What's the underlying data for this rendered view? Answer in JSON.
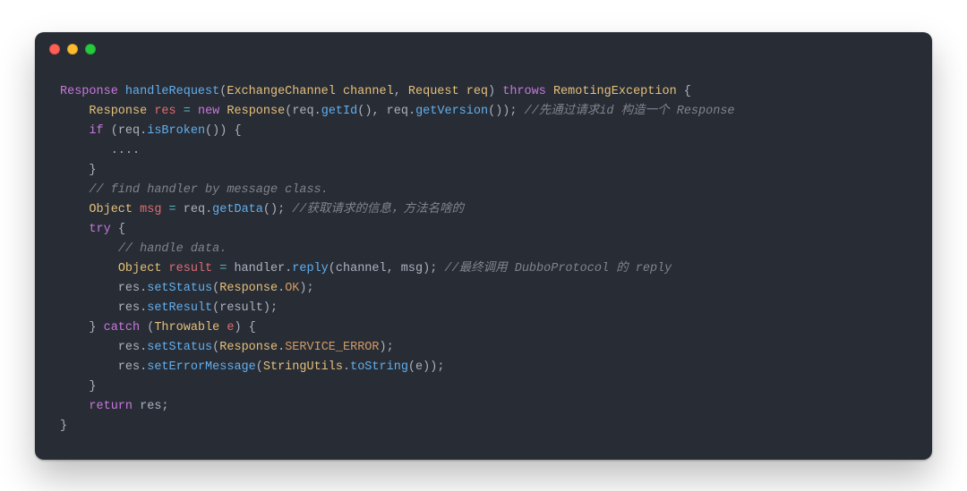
{
  "code": {
    "lines": [
      [
        {
          "cls": "tk-type",
          "t": "Response "
        },
        {
          "cls": "tk-method",
          "t": "handleRequest"
        },
        {
          "cls": "tk-punct",
          "t": "("
        },
        {
          "cls": "tk-param",
          "t": "ExchangeChannel channel"
        },
        {
          "cls": "tk-punct",
          "t": ", "
        },
        {
          "cls": "tk-param",
          "t": "Request req"
        },
        {
          "cls": "tk-punct",
          "t": ") "
        },
        {
          "cls": "tk-keyword",
          "t": "throws"
        },
        {
          "cls": "tk-punct",
          "t": " "
        },
        {
          "cls": "tk-class",
          "t": "RemotingException"
        },
        {
          "cls": "tk-punct",
          "t": " {"
        }
      ],
      [
        {
          "cls": "tk-plain",
          "t": "    "
        },
        {
          "cls": "tk-class",
          "t": "Response"
        },
        {
          "cls": "tk-plain",
          "t": " "
        },
        {
          "cls": "tk-var",
          "t": "res"
        },
        {
          "cls": "tk-plain",
          "t": " "
        },
        {
          "cls": "tk-op",
          "t": "="
        },
        {
          "cls": "tk-plain",
          "t": " "
        },
        {
          "cls": "tk-new",
          "t": "new"
        },
        {
          "cls": "tk-plain",
          "t": " "
        },
        {
          "cls": "tk-class",
          "t": "Response"
        },
        {
          "cls": "tk-punct",
          "t": "("
        },
        {
          "cls": "tk-plain",
          "t": "req"
        },
        {
          "cls": "tk-punct",
          "t": "."
        },
        {
          "cls": "tk-call",
          "t": "getId"
        },
        {
          "cls": "tk-punct",
          "t": "(), "
        },
        {
          "cls": "tk-plain",
          "t": "req"
        },
        {
          "cls": "tk-punct",
          "t": "."
        },
        {
          "cls": "tk-call",
          "t": "getVersion"
        },
        {
          "cls": "tk-punct",
          "t": "()); "
        },
        {
          "cls": "tk-comment",
          "t": "//先通过请求id 构造一个 Response"
        }
      ],
      [
        {
          "cls": "tk-plain",
          "t": "    "
        },
        {
          "cls": "tk-keyword",
          "t": "if"
        },
        {
          "cls": "tk-punct",
          "t": " ("
        },
        {
          "cls": "tk-plain",
          "t": "req"
        },
        {
          "cls": "tk-punct",
          "t": "."
        },
        {
          "cls": "tk-call",
          "t": "isBroken"
        },
        {
          "cls": "tk-punct",
          "t": "()) {"
        }
      ],
      [
        {
          "cls": "tk-plain",
          "t": "       ...."
        }
      ],
      [
        {
          "cls": "tk-plain",
          "t": "    }"
        }
      ],
      [
        {
          "cls": "tk-plain",
          "t": "    "
        },
        {
          "cls": "tk-comment",
          "t": "// find handler by message class."
        }
      ],
      [
        {
          "cls": "tk-plain",
          "t": "    "
        },
        {
          "cls": "tk-class",
          "t": "Object"
        },
        {
          "cls": "tk-plain",
          "t": " "
        },
        {
          "cls": "tk-var",
          "t": "msg"
        },
        {
          "cls": "tk-plain",
          "t": " "
        },
        {
          "cls": "tk-op",
          "t": "="
        },
        {
          "cls": "tk-plain",
          "t": " req"
        },
        {
          "cls": "tk-punct",
          "t": "."
        },
        {
          "cls": "tk-call",
          "t": "getData"
        },
        {
          "cls": "tk-punct",
          "t": "(); "
        },
        {
          "cls": "tk-comment",
          "t": "//获取请求的信息，方法名啥的"
        }
      ],
      [
        {
          "cls": "tk-plain",
          "t": "    "
        },
        {
          "cls": "tk-keyword",
          "t": "try"
        },
        {
          "cls": "tk-punct",
          "t": " {"
        }
      ],
      [
        {
          "cls": "tk-plain",
          "t": "        "
        },
        {
          "cls": "tk-comment",
          "t": "// handle data."
        }
      ],
      [
        {
          "cls": "tk-plain",
          "t": "        "
        },
        {
          "cls": "tk-class",
          "t": "Object"
        },
        {
          "cls": "tk-plain",
          "t": " "
        },
        {
          "cls": "tk-var",
          "t": "result"
        },
        {
          "cls": "tk-plain",
          "t": " "
        },
        {
          "cls": "tk-op",
          "t": "="
        },
        {
          "cls": "tk-plain",
          "t": " handler"
        },
        {
          "cls": "tk-punct",
          "t": "."
        },
        {
          "cls": "tk-call",
          "t": "reply"
        },
        {
          "cls": "tk-punct",
          "t": "(channel, msg); "
        },
        {
          "cls": "tk-comment",
          "t": "//最终调用 DubboProtocol 的 reply"
        }
      ],
      [
        {
          "cls": "tk-plain",
          "t": "        res"
        },
        {
          "cls": "tk-punct",
          "t": "."
        },
        {
          "cls": "tk-call",
          "t": "setStatus"
        },
        {
          "cls": "tk-punct",
          "t": "("
        },
        {
          "cls": "tk-class",
          "t": "Response"
        },
        {
          "cls": "tk-punct",
          "t": "."
        },
        {
          "cls": "tk-const",
          "t": "OK"
        },
        {
          "cls": "tk-punct",
          "t": ");"
        }
      ],
      [
        {
          "cls": "tk-plain",
          "t": "        res"
        },
        {
          "cls": "tk-punct",
          "t": "."
        },
        {
          "cls": "tk-call",
          "t": "setResult"
        },
        {
          "cls": "tk-punct",
          "t": "(result);"
        }
      ],
      [
        {
          "cls": "tk-plain",
          "t": "    } "
        },
        {
          "cls": "tk-keyword",
          "t": "catch"
        },
        {
          "cls": "tk-punct",
          "t": " ("
        },
        {
          "cls": "tk-class",
          "t": "Throwable"
        },
        {
          "cls": "tk-plain",
          "t": " "
        },
        {
          "cls": "tk-var",
          "t": "e"
        },
        {
          "cls": "tk-punct",
          "t": ") {"
        }
      ],
      [
        {
          "cls": "tk-plain",
          "t": "        res"
        },
        {
          "cls": "tk-punct",
          "t": "."
        },
        {
          "cls": "tk-call",
          "t": "setStatus"
        },
        {
          "cls": "tk-punct",
          "t": "("
        },
        {
          "cls": "tk-class",
          "t": "Response"
        },
        {
          "cls": "tk-punct",
          "t": "."
        },
        {
          "cls": "tk-const",
          "t": "SERVICE_ERROR"
        },
        {
          "cls": "tk-punct",
          "t": ");"
        }
      ],
      [
        {
          "cls": "tk-plain",
          "t": "        res"
        },
        {
          "cls": "tk-punct",
          "t": "."
        },
        {
          "cls": "tk-call",
          "t": "setErrorMessage"
        },
        {
          "cls": "tk-punct",
          "t": "("
        },
        {
          "cls": "tk-class",
          "t": "StringUtils"
        },
        {
          "cls": "tk-punct",
          "t": "."
        },
        {
          "cls": "tk-call",
          "t": "toString"
        },
        {
          "cls": "tk-punct",
          "t": "(e));"
        }
      ],
      [
        {
          "cls": "tk-plain",
          "t": "    }"
        }
      ],
      [
        {
          "cls": "tk-plain",
          "t": "    "
        },
        {
          "cls": "tk-keyword",
          "t": "return"
        },
        {
          "cls": "tk-plain",
          "t": " res;"
        }
      ],
      [
        {
          "cls": "tk-plain",
          "t": "}"
        }
      ]
    ]
  }
}
